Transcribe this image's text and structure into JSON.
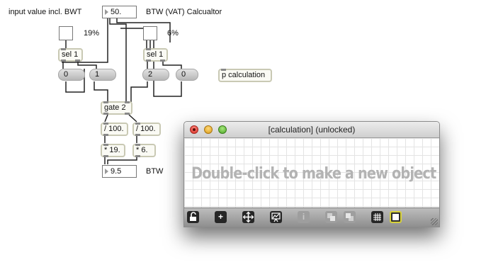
{
  "labels": {
    "input_label": "input value incl. BWT",
    "title_label": "BTW (VAT) Calcualtor",
    "pct19": "19%",
    "pct6": "6%",
    "btw": "BTW"
  },
  "numboxes": {
    "input_value": "50.",
    "output_value": "9.5"
  },
  "objects": {
    "sel1_left": "sel 1",
    "sel1_right": "sel 1",
    "p_calc": "p calculation",
    "gate": "gate 2",
    "div_left": "/ 100.",
    "div_right": "/ 100.",
    "mul_left": "* 19.",
    "mul_right": "* 6."
  },
  "messages": {
    "m0a": "0",
    "m1": "1",
    "m2": "2",
    "m0b": "0"
  },
  "window": {
    "title": "[calculation] (unlocked)",
    "hint": "Double-click to make a new object",
    "toolbar": [
      "lock-icon",
      "add-object-icon",
      "move-icon",
      "presentation-icon",
      "info-icon",
      "layer-front-icon",
      "layer-back-icon",
      "grid-icon",
      "snap-icon"
    ]
  }
}
